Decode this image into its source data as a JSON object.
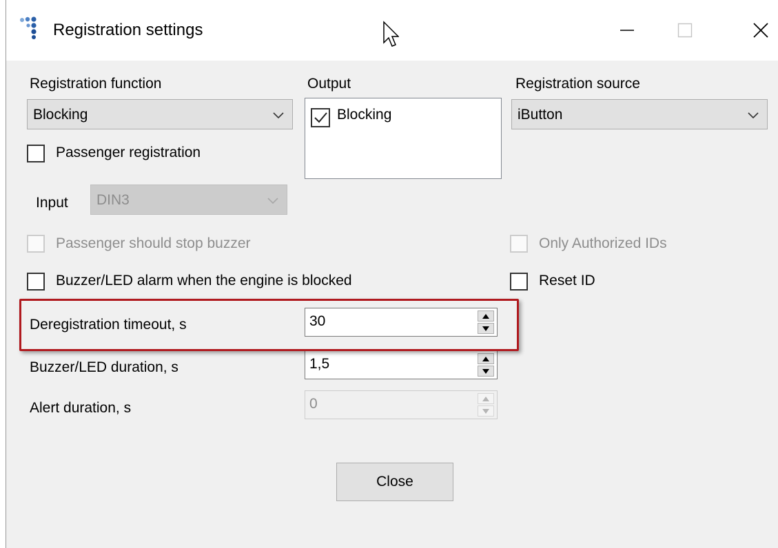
{
  "window": {
    "title": "Registration settings",
    "minimize_icon": "minimize-icon",
    "maximize_icon": "maximize-icon",
    "close_icon": "close-icon"
  },
  "registration_function": {
    "label": "Registration function",
    "selected": "Blocking"
  },
  "output": {
    "label": "Output",
    "items": [
      {
        "label": "Blocking",
        "checked": true
      }
    ]
  },
  "registration_source": {
    "label": "Registration source",
    "selected": "iButton"
  },
  "passenger_registration": {
    "label": "Passenger registration",
    "checked": false
  },
  "input": {
    "label": "Input",
    "selected": "DIN3",
    "enabled": false
  },
  "passenger_stop_buzzer": {
    "label": "Passenger should stop buzzer",
    "checked": false,
    "enabled": false
  },
  "only_authorized_ids": {
    "label": "Only Authorized IDs",
    "checked": false,
    "enabled": false
  },
  "buzzer_alarm": {
    "label": "Buzzer/LED alarm when the engine is blocked",
    "checked": false
  },
  "reset_id": {
    "label": "Reset ID",
    "checked": false
  },
  "deregistration_timeout": {
    "label": "Deregistration timeout, s",
    "value": "30"
  },
  "buzzer_duration": {
    "label": "Buzzer/LED duration, s",
    "value": "1,5"
  },
  "alert_duration": {
    "label": "Alert duration, s",
    "value": "0",
    "enabled": false
  },
  "close_button": {
    "label": "Close"
  },
  "colors": {
    "highlight": "#b0191e",
    "window_bg": "#f0f0f0"
  }
}
